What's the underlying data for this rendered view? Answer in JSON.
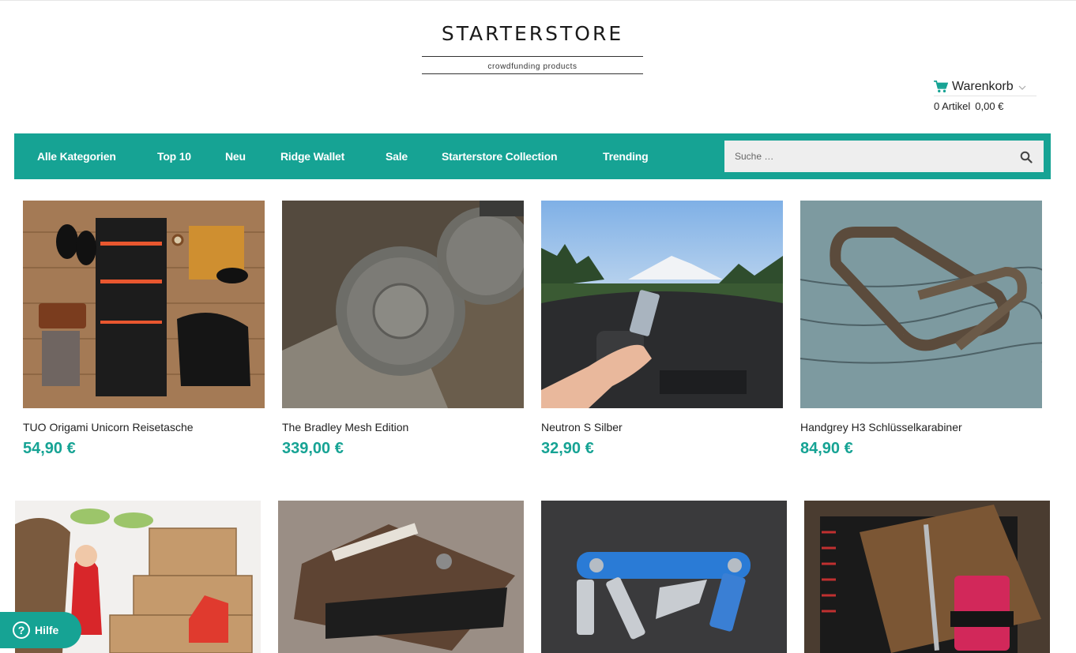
{
  "logo": {
    "title": "STARTERSTORE",
    "subtitle": "crowdfunding products"
  },
  "cart": {
    "label": "Warenkorb",
    "count": "0 Artikel",
    "total": "0,00 €"
  },
  "nav": {
    "items": [
      "Alle Kategorien",
      "Top 10",
      "Neu",
      "Ridge Wallet",
      "Sale",
      "Starterstore Collection",
      "Trending"
    ]
  },
  "search": {
    "placeholder": "Suche …"
  },
  "products": [
    {
      "name": "TUO Origami Unicorn Reisetasche",
      "price": "54,90 €"
    },
    {
      "name": "The Bradley Mesh Edition",
      "price": "339,00 €"
    },
    {
      "name": "Neutron S Silber",
      "price": "32,90 €"
    },
    {
      "name": "Handgrey H3 Schlüsselkarabiner",
      "price": "84,90 €"
    }
  ],
  "help": {
    "label": "Hilfe",
    "icon": "?"
  },
  "colors": {
    "accent": "#16a394",
    "text": "#222222"
  }
}
